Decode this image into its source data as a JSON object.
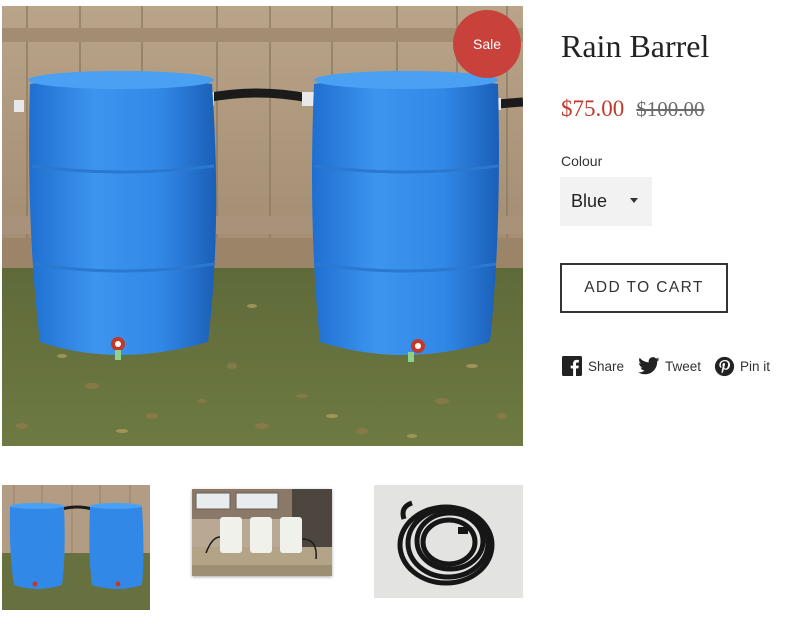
{
  "badge": {
    "label": "Sale"
  },
  "product": {
    "title": "Rain Barrel",
    "sale_price": "$75.00",
    "compare_price": "$100.00",
    "sale_color": "#c0392b",
    "badge_color": "#c8413a"
  },
  "variant": {
    "label": "Colour",
    "selected": "Blue"
  },
  "actions": {
    "add_to_cart": "ADD TO CART"
  },
  "social": {
    "share": "Share",
    "tweet": "Tweet",
    "pin": "Pin it"
  },
  "images": {
    "main": "blue-rain-barrels-image",
    "thumbnails": [
      "blue-rain-barrels-thumbnail",
      "white-barrels-house-thumbnail",
      "black-hose-coil-thumbnail"
    ]
  }
}
